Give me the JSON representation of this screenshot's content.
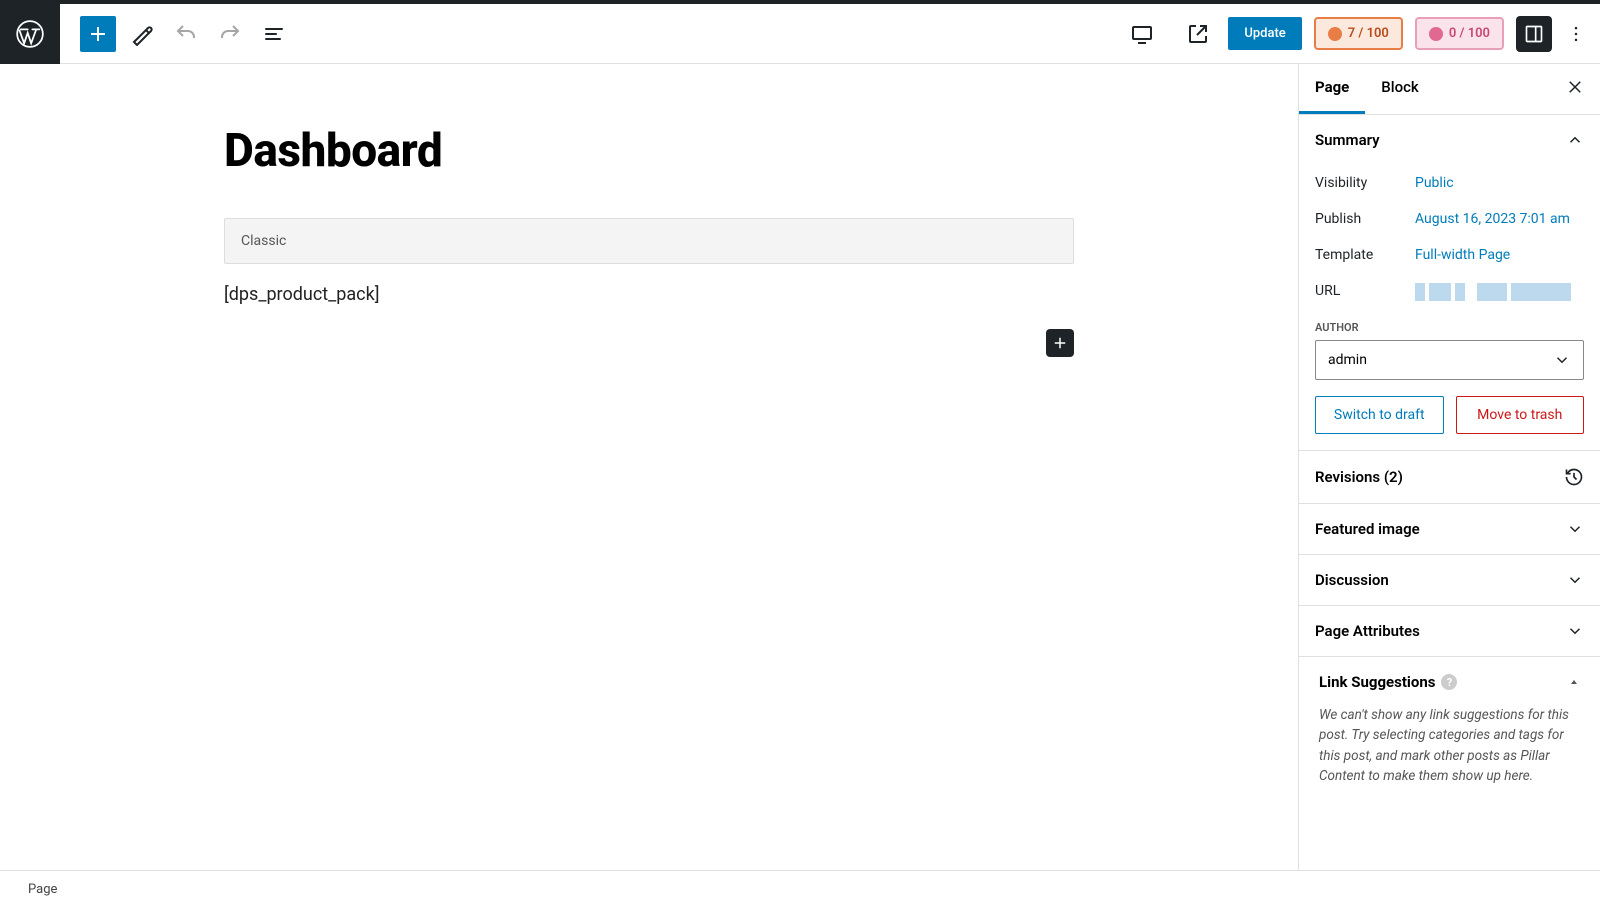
{
  "header": {
    "update_label": "Update",
    "score1": "7 / 100",
    "score2": "0 / 100"
  },
  "editor": {
    "title": "Dashboard",
    "classic_label": "Classic",
    "shortcode": "[dps_product_pack]"
  },
  "tabs": {
    "page": "Page",
    "block": "Block"
  },
  "summary": {
    "heading": "Summary",
    "visibility_label": "Visibility",
    "visibility_value": "Public",
    "publish_label": "Publish",
    "publish_value": "August 16, 2023 7:01 am",
    "template_label": "Template",
    "template_value": "Full-width Page",
    "url_label": "URL",
    "author_label": "AUTHOR",
    "author_value": "admin",
    "draft_label": "Switch to draft",
    "trash_label": "Move to trash"
  },
  "panels": {
    "revisions": "Revisions (2)",
    "featured": "Featured image",
    "discussion": "Discussion",
    "attributes": "Page Attributes",
    "link_heading": "Link Suggestions",
    "link_text": "We can't show any link suggestions for this post. Try selecting categories and tags for this post, and mark other posts as Pillar Content to make them show up here."
  },
  "footer": {
    "breadcrumb": "Page"
  }
}
